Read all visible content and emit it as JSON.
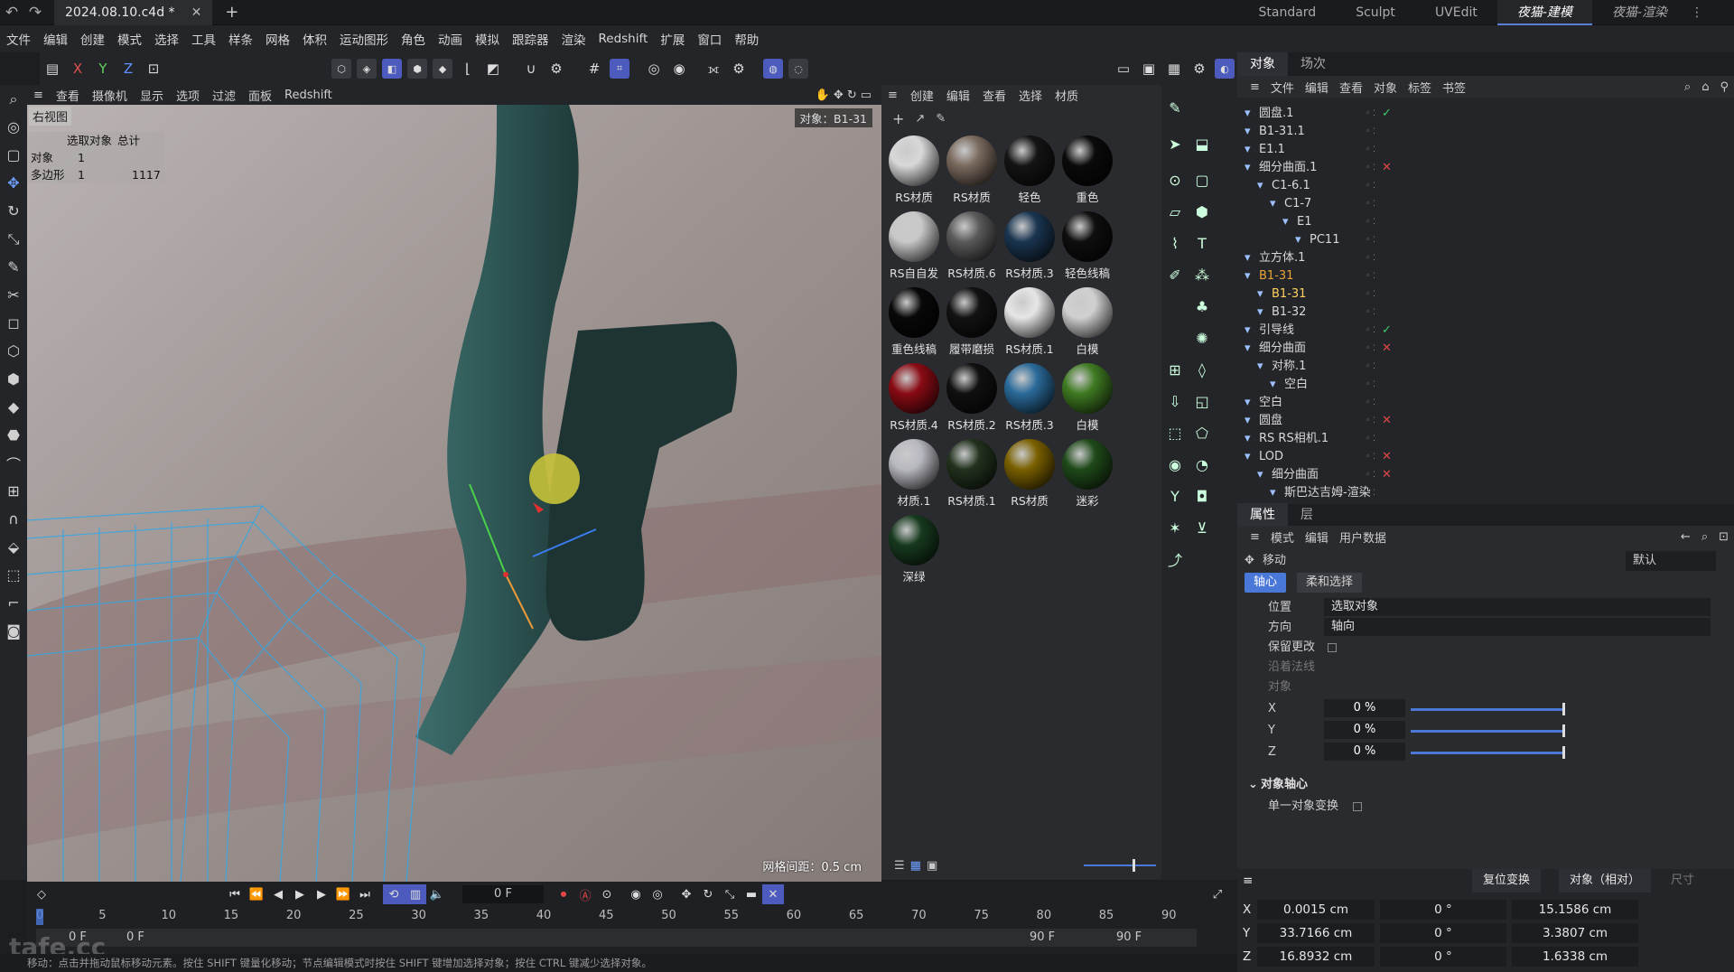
{
  "titlebar": {
    "file_tab": "2024.08.10.c4d *",
    "layouts": [
      "Standard",
      "Sculpt",
      "UVEdit",
      "夜猫-建模",
      "夜猫-渲染"
    ]
  },
  "menubar": [
    "文件",
    "编辑",
    "创建",
    "模式",
    "选择",
    "工具",
    "样条",
    "网格",
    "体积",
    "运动图形",
    "角色",
    "动画",
    "模拟",
    "跟踪器",
    "渲染",
    "Redshift",
    "扩展",
    "窗口",
    "帮助"
  ],
  "toolbar": {
    "axes": [
      "X",
      "Y",
      "Z"
    ]
  },
  "viewport": {
    "menu": [
      "查看",
      "摄像机",
      "显示",
      "选项",
      "过滤",
      "面板",
      "Redshift"
    ],
    "label": "右视图",
    "stats_header": [
      "选取对象",
      "总计"
    ],
    "stats": [
      {
        "label": "对象",
        "selected": "1",
        "total": ""
      },
      {
        "label": "多边形",
        "selected": "1",
        "total": "1117"
      }
    ],
    "object_label": "对象：B1-31",
    "grid_spacing": "网格间距：0.5 cm"
  },
  "materials": {
    "menu": [
      "创建",
      "编辑",
      "查看",
      "选择",
      "材质"
    ],
    "items": [
      {
        "name": "RS材质",
        "color": "#d8d8d8"
      },
      {
        "name": "RS材质",
        "color": "#7a6a5e"
      },
      {
        "name": "轻色",
        "color": "#141414"
      },
      {
        "name": "重色",
        "color": "#0a0a0a"
      },
      {
        "name": "RS自自发",
        "color": "#c8c8c8"
      },
      {
        "name": "RS材质.6",
        "color": "#5a5a5a"
      },
      {
        "name": "RS材质.3",
        "color": "#1a3550"
      },
      {
        "name": "轻色线稿",
        "color": "#0e0e0e"
      },
      {
        "name": "重色线稿",
        "color": "#080808"
      },
      {
        "name": "履带磨损",
        "color": "#121212"
      },
      {
        "name": "RS材质.1",
        "color": "#e6e6e6"
      },
      {
        "name": "白模",
        "color": "#d0d0d0"
      },
      {
        "name": "RS材质.4",
        "color": "#8a0b14"
      },
      {
        "name": "RS材质.2",
        "color": "#101010"
      },
      {
        "name": "RS材质.3",
        "color": "#2a6a9a"
      },
      {
        "name": "白模",
        "color": "#3f7a22"
      },
      {
        "name": "材质.1",
        "color": "#b8b8c0"
      },
      {
        "name": "RS材质.1",
        "color": "#22321e"
      },
      {
        "name": "RS材质",
        "color": "#7a6000"
      },
      {
        "name": "迷彩",
        "color": "#1f4a1a"
      },
      {
        "name": "深绿",
        "color": "#173a1e"
      }
    ]
  },
  "object_manager": {
    "tabs": [
      "对象",
      "场次"
    ],
    "menu": [
      "文件",
      "编辑",
      "查看",
      "对象",
      "标签",
      "书签"
    ],
    "items": [
      {
        "name": "圆盘.1",
        "indent": 0,
        "status": "check"
      },
      {
        "name": "B1-31.1",
        "indent": 0,
        "status": ""
      },
      {
        "name": "E1.1",
        "indent": 0,
        "status": ""
      },
      {
        "name": "细分曲面.1",
        "indent": 0,
        "status": "x"
      },
      {
        "name": "C1-6.1",
        "indent": 1,
        "status": ""
      },
      {
        "name": "C1-7",
        "indent": 2,
        "status": ""
      },
      {
        "name": "E1",
        "indent": 3,
        "status": ""
      },
      {
        "name": "PC11",
        "indent": 4,
        "status": ""
      },
      {
        "name": "立方体.1",
        "indent": 0,
        "status": ""
      },
      {
        "name": "B1-31",
        "indent": 0,
        "status": "",
        "highlight": "#e8a53a"
      },
      {
        "name": "B1-31",
        "indent": 1,
        "status": "",
        "highlight": "#ffd060"
      },
      {
        "name": "B1-32",
        "indent": 1,
        "status": ""
      },
      {
        "name": "引导线",
        "indent": 0,
        "status": "check"
      },
      {
        "name": "细分曲面",
        "indent": 0,
        "status": "x"
      },
      {
        "name": "对称.1",
        "indent": 1,
        "status": ""
      },
      {
        "name": "空白",
        "indent": 2,
        "status": ""
      },
      {
        "name": "空白",
        "indent": 0,
        "status": ""
      },
      {
        "name": "圆盘",
        "indent": 0,
        "status": "x"
      },
      {
        "name": "RS RS相机.1",
        "indent": 0,
        "status": ""
      },
      {
        "name": "LOD",
        "indent": 0,
        "status": "x"
      },
      {
        "name": "细分曲面",
        "indent": 1,
        "status": "x"
      },
      {
        "name": "斯巴达吉姆-渲染",
        "indent": 2,
        "status": ""
      }
    ]
  },
  "attributes": {
    "tabs": [
      "属性",
      "层"
    ],
    "menu": [
      "模式",
      "编辑",
      "用户数据"
    ],
    "tool": "移动",
    "preset": "默认",
    "subtabs": [
      "轴心",
      "柔和选择"
    ],
    "position_label": "位置",
    "position_value": "选取对象",
    "direction_label": "方向",
    "direction_value": "轴向",
    "keep_changes": "保留更改",
    "along_normal": "沿着法线",
    "object_label": "对象",
    "x_label": "X",
    "x_value": "0 %",
    "y_label": "Y",
    "y_value": "0 %",
    "z_label": "Z",
    "z_value": "0 %",
    "section": "对象轴心",
    "single_transform": "单一对象变换"
  },
  "coordinates": {
    "reset": "复位变换",
    "mode": "对象（相对）",
    "size_label": "尺寸",
    "rows": [
      {
        "axis": "X",
        "pos": "0.0015 cm",
        "rot": "0 °",
        "size": "15.1586 cm"
      },
      {
        "axis": "Y",
        "pos": "33.7166 cm",
        "rot": "0 °",
        "size": "3.3807 cm"
      },
      {
        "axis": "Z",
        "pos": "16.8932 cm",
        "rot": "0 °",
        "size": "1.6338 cm"
      }
    ]
  },
  "timeline": {
    "current_frame": "0 F",
    "ticks": [
      "0",
      "5",
      "10",
      "15",
      "20",
      "25",
      "30",
      "35",
      "40",
      "45",
      "50",
      "55",
      "60",
      "65",
      "70",
      "75",
      "80",
      "85",
      "90"
    ],
    "start": "0 F",
    "start2": "0 F",
    "end": "90 F",
    "end2": "90 F"
  },
  "status_text": "移动：点击并拖动鼠标移动元素。按住 SHIFT 键量化移动；节点编辑模式时按住 SHIFT 键增加选择对象；按住 CTRL 键减少选择对象。",
  "watermark": "tafe.cc"
}
